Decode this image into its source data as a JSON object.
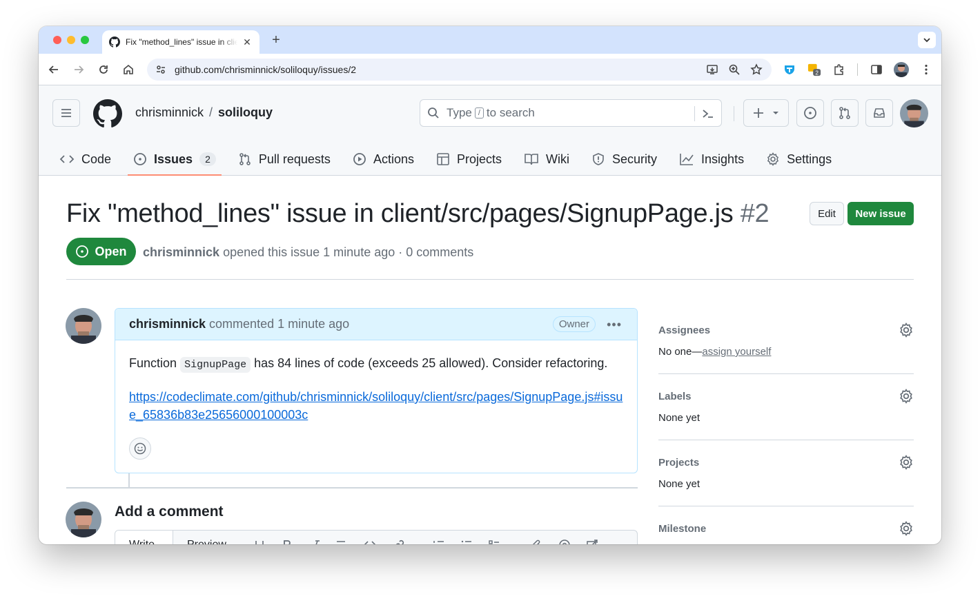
{
  "browser": {
    "tab_title": "Fix \"method_lines\" issue in client/src/pages/SignupPage.js",
    "new_tab": "+",
    "tab_close": "✕",
    "url": "github.com/chrisminnick/soliloquy/issues/2",
    "extension_badge": "2"
  },
  "header": {
    "owner": "chrisminnick",
    "separator": "/",
    "repo": "soliloquy",
    "search_placeholder_pre": "Type",
    "search_key": "/",
    "search_placeholder_post": "to search"
  },
  "nav": {
    "code": "Code",
    "issues": "Issues",
    "issues_count": "2",
    "pulls": "Pull requests",
    "actions": "Actions",
    "projects": "Projects",
    "wiki": "Wiki",
    "security": "Security",
    "insights": "Insights",
    "settings": "Settings"
  },
  "issue": {
    "title": "Fix \"method_lines\" issue in client/src/pages/SignupPage.js",
    "number": "#2",
    "edit_label": "Edit",
    "new_issue_label": "New issue",
    "state": "Open",
    "author": "chrisminnick",
    "meta_text": "opened this issue 1 minute ago · 0 comments"
  },
  "comment": {
    "author": "chrisminnick",
    "action": "commented 1 minute ago",
    "role_badge": "Owner",
    "body_pre": "Function",
    "body_code": "SignupPage",
    "body_post": "has 84 lines of code (exceeds 25 allowed). Consider refactoring.",
    "link": "https://codeclimate.com/github/chrisminnick/soliloquy/client/src/pages/SignupPage.js#issue_65836b83e25656000100003c"
  },
  "add_comment": {
    "heading": "Add a comment",
    "write_tab": "Write",
    "preview_tab": "Preview"
  },
  "sidebar": {
    "assignees_title": "Assignees",
    "assignees_value": "No one—",
    "assign_yourself": "assign yourself",
    "labels_title": "Labels",
    "labels_value": "None yet",
    "projects_title": "Projects",
    "projects_value": "None yet",
    "milestone_title": "Milestone"
  },
  "colors": {
    "open_green": "#1f883d",
    "link_blue": "#0969da",
    "active_tab_underline": "#fd8c73",
    "comment_header_bg": "#ddf4ff"
  }
}
